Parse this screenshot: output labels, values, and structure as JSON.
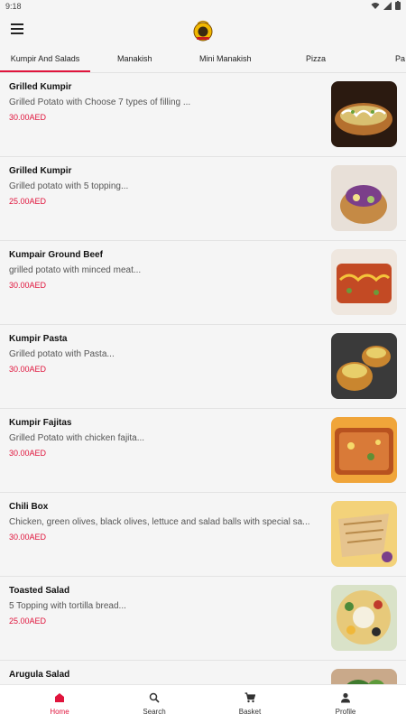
{
  "status": {
    "time": "9:18"
  },
  "tabs": [
    {
      "label": "Kumpir And Salads"
    },
    {
      "label": "Manakish"
    },
    {
      "label": "Mini Manakish"
    },
    {
      "label": "Pizza"
    },
    {
      "label": "Pa"
    }
  ],
  "items": [
    {
      "name": "Grilled Kumpir",
      "desc": "Grilled Potato with Choose 7 types of filling ...",
      "price": "30.00AED"
    },
    {
      "name": "Grilled Kumpir",
      "desc": "Grilled potato with 5 topping...",
      "price": "25.00AED"
    },
    {
      "name": "Kumpair Ground Beef",
      "desc": "grilled potato with minced meat...",
      "price": "30.00AED"
    },
    {
      "name": "Kumpir Pasta",
      "desc": "Grilled potato with Pasta...",
      "price": "30.00AED"
    },
    {
      "name": "Kumpir Fajitas",
      "desc": "Grilled Potato with chicken fajita...",
      "price": "30.00AED"
    },
    {
      "name": "Chili Box",
      "desc": "Chicken, green olives, black olives, lettuce and salad balls with special sa...",
      "price": "30.00AED"
    },
    {
      "name": "Toasted Salad",
      "desc": "5 Topping with tortilla bread...",
      "price": "25.00AED"
    },
    {
      "name": "Arugula Salad",
      "desc": "",
      "price": ""
    }
  ],
  "nav": {
    "home": "Home",
    "search": "Search",
    "basket": "Basket",
    "profile": "Profile"
  },
  "colors": {
    "accent": "#e0143c",
    "background": "#f5f5f5"
  }
}
